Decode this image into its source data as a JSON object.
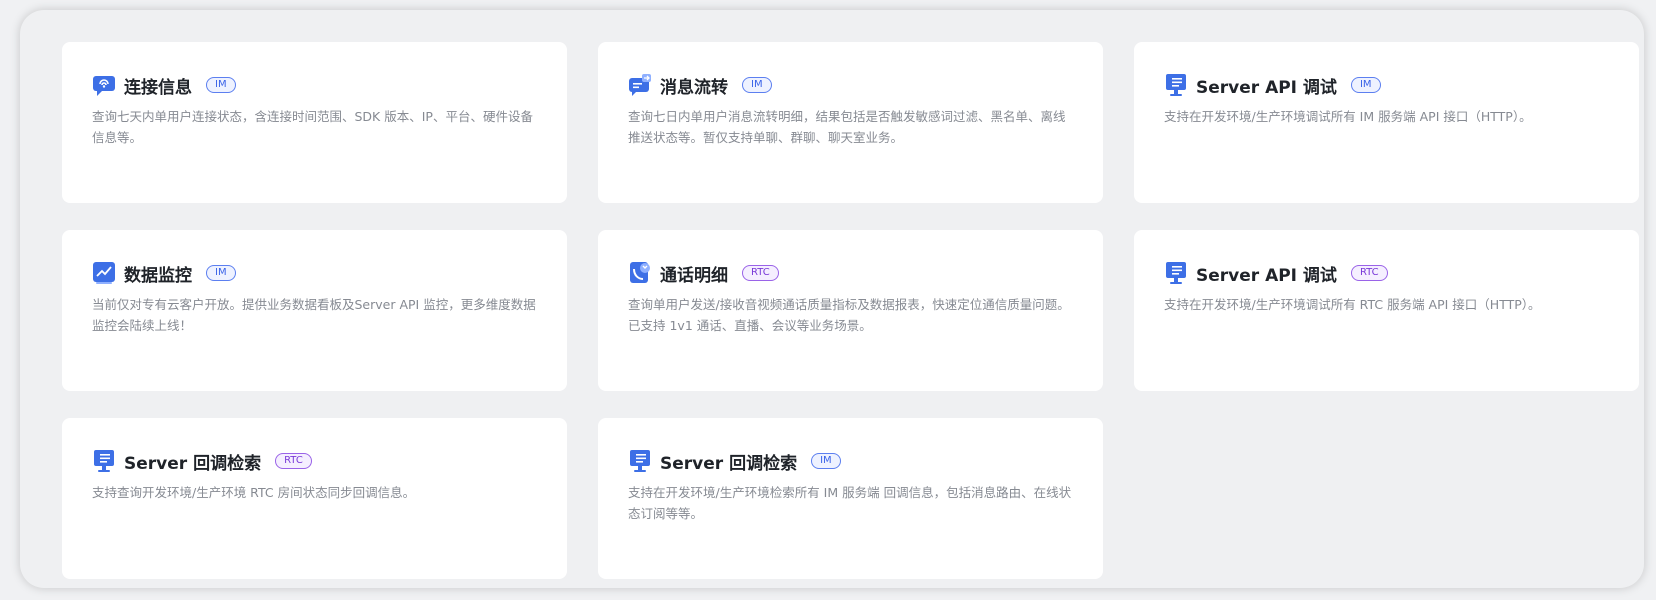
{
  "cards": [
    {
      "title": "连接信息",
      "badge": "IM",
      "badge_type": "im",
      "icon": "connection-chat-icon",
      "desc": "查询七天内单用户连接状态，含连接时间范围、SDK 版本、IP、平台、硬件设备信息等。"
    },
    {
      "title": "消息流转",
      "badge": "IM",
      "badge_type": "im",
      "icon": "message-forward-icon",
      "desc": "查询七日内单用户消息流转明细，结果包括是否触发敏感词过滤、黑名单、离线推送状态等。暂仅支持单聊、群聊、聊天室业务。"
    },
    {
      "title": "Server API 调试",
      "badge": "IM",
      "badge_type": "im",
      "icon": "server-monitor-icon",
      "desc": "支持在开发环境/生产环境调试所有 IM 服务端 API 接口（HTTP）。"
    },
    {
      "title": "数据监控",
      "badge": "IM",
      "badge_type": "im",
      "icon": "chart-monitor-icon",
      "desc": "当前仅对专有云客户开放。提供业务数据看板及Server API 监控，更多维度数据监控会陆续上线！"
    },
    {
      "title": "通话明细",
      "badge": "RTC",
      "badge_type": "rtc",
      "icon": "phone-call-icon",
      "desc": "查询单用户发送/接收音视频通话质量指标及数据报表，快速定位通信质量问题。已支持 1v1 通话、直播、会议等业务场景。"
    },
    {
      "title": "Server API 调试",
      "badge": "RTC",
      "badge_type": "rtc",
      "icon": "server-monitor-icon",
      "desc": "支持在开发环境/生产环境调试所有 RTC 服务端 API 接口（HTTP）。"
    },
    {
      "title": "Server 回调检索",
      "badge": "RTC",
      "badge_type": "rtc",
      "icon": "server-monitor-icon",
      "desc": "支持查询开发环境/生产环境 RTC 房间状态同步回调信息。"
    },
    {
      "title": "Server 回调检索",
      "badge": "IM",
      "badge_type": "im",
      "icon": "server-monitor-icon",
      "desc": "支持在开发环境/生产环境检索所有 IM 服务端 回调信息，包括消息路由、在线状态订阅等等。"
    }
  ],
  "colors": {
    "im_badge": "#3a63e8",
    "rtc_badge": "#7a3ad8",
    "icon_blue": "#3d6fe6"
  }
}
